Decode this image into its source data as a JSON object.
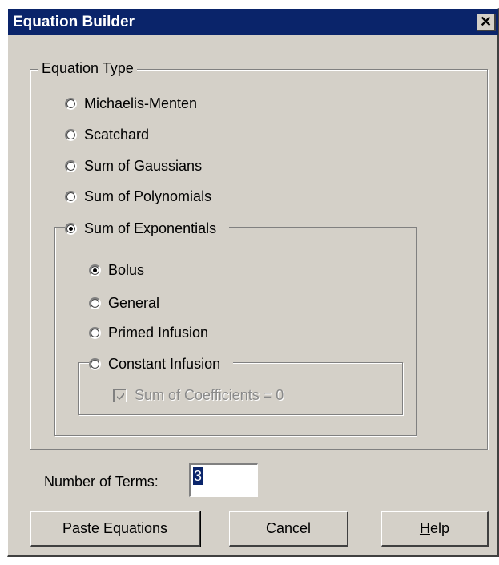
{
  "window": {
    "title": "Equation Builder",
    "close_glyph": "✕"
  },
  "equation_type": {
    "label": "Equation Type",
    "options": [
      {
        "label": "Michaelis-Menten",
        "checked": false
      },
      {
        "label": "Scatchard",
        "checked": false
      },
      {
        "label": "Sum of Gaussians",
        "checked": false
      },
      {
        "label": "Sum of Polynomials",
        "checked": false
      },
      {
        "label": "Sum of Exponentials",
        "checked": true
      }
    ]
  },
  "exponentials": {
    "options": [
      {
        "label": "Bolus",
        "checked": true
      },
      {
        "label": "General",
        "checked": false
      },
      {
        "label": "Primed Infusion",
        "checked": false
      },
      {
        "label": "Constant Infusion",
        "checked": false
      }
    ],
    "sum_of_coefficients": {
      "label": "Sum of Coefficients = 0",
      "checked": true,
      "disabled": true
    }
  },
  "terms": {
    "label": "Number of Terms:",
    "value": "3"
  },
  "buttons": {
    "paste": "Paste Equations",
    "cancel": "Cancel",
    "help_mnemonic": "H",
    "help_rest": "elp"
  }
}
